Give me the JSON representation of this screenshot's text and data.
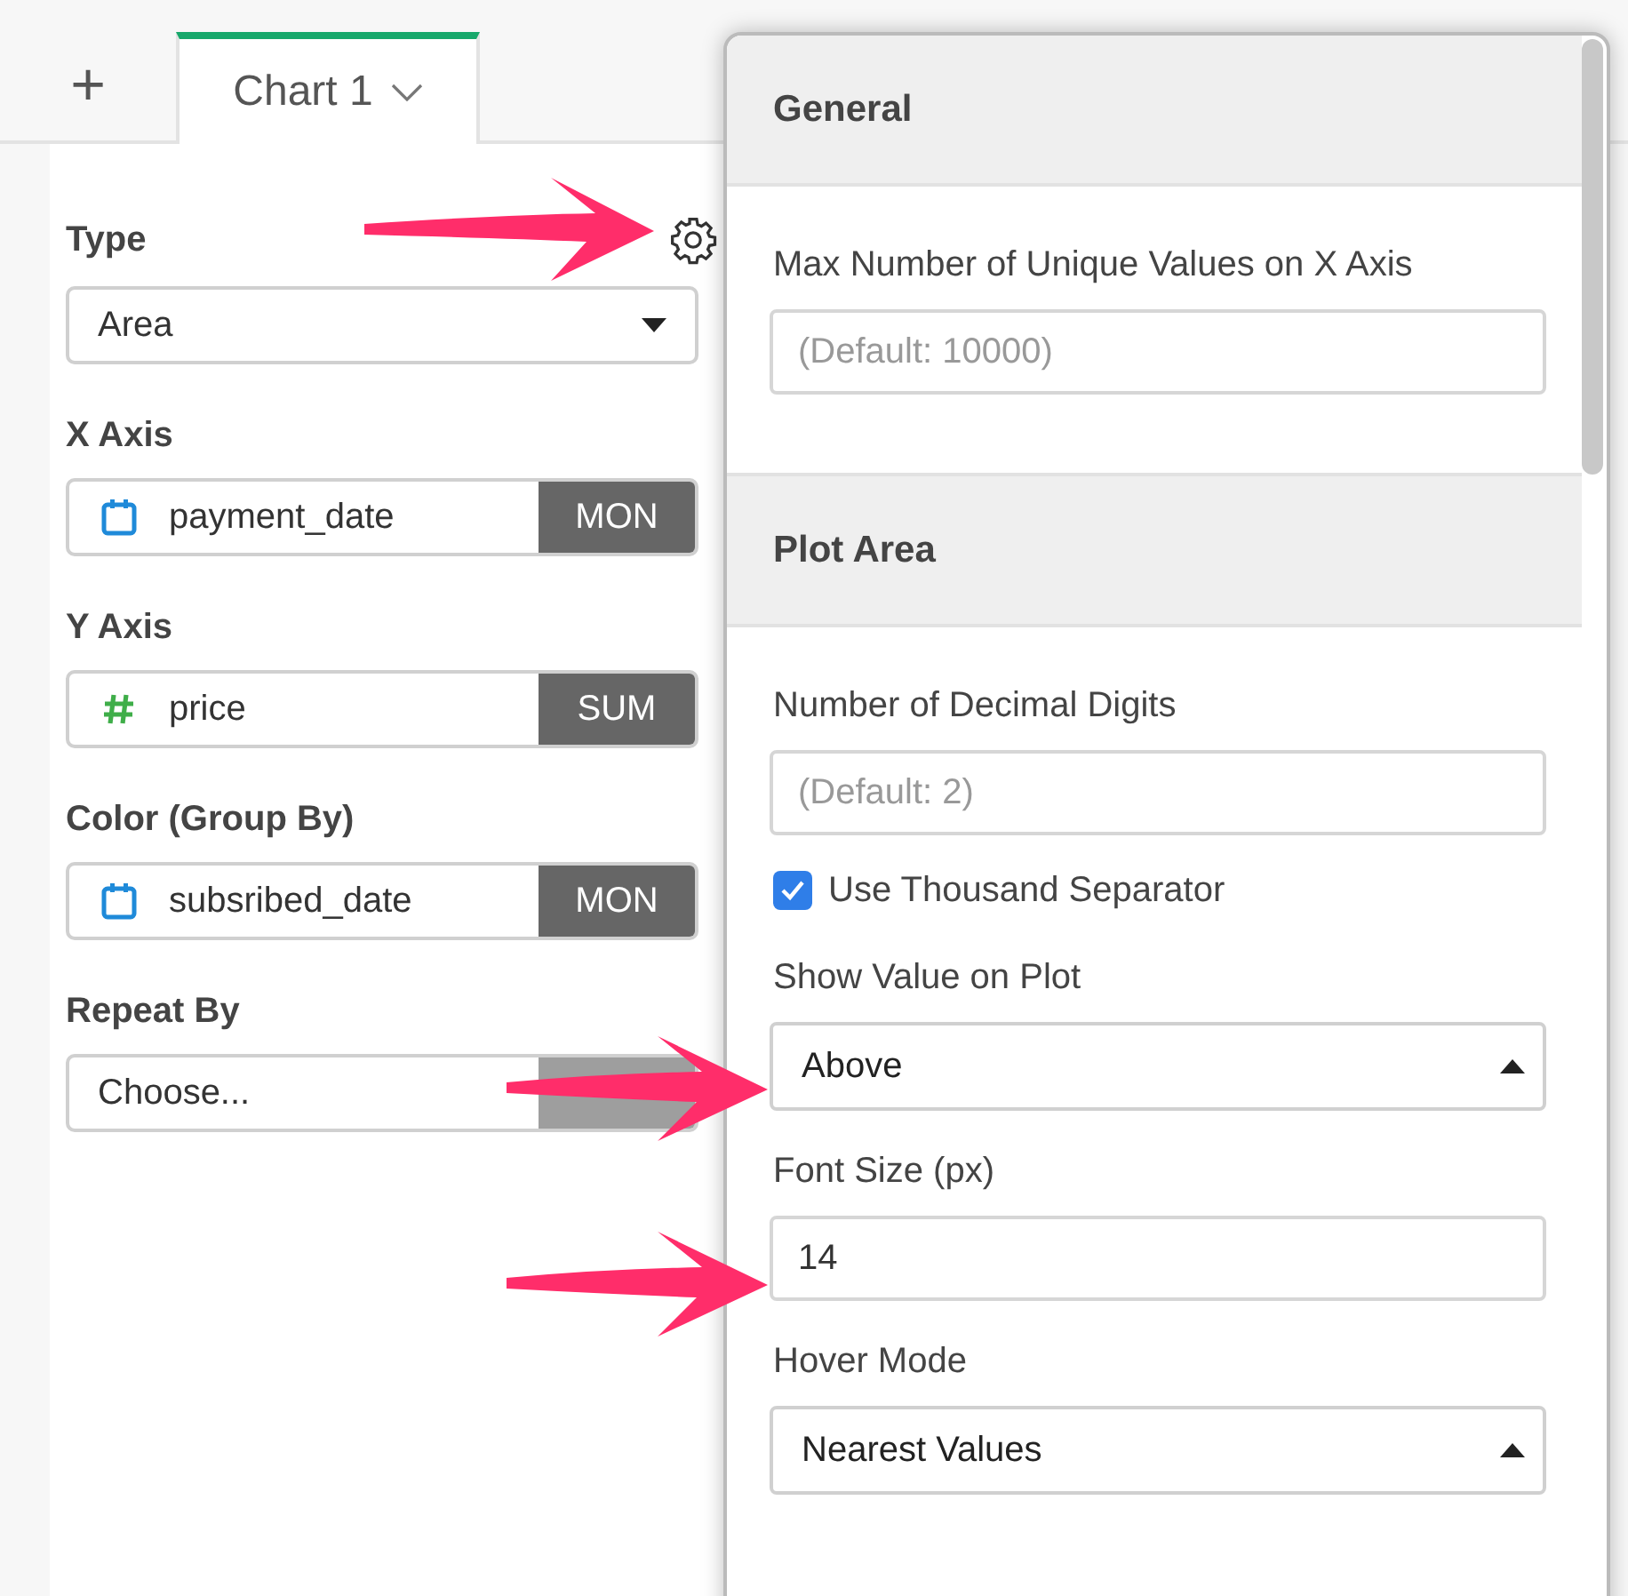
{
  "tabs": {
    "add_label": "+",
    "items": [
      {
        "label": "Chart 1",
        "selected": true
      }
    ]
  },
  "left_panel": {
    "fields": [
      {
        "kind": "select",
        "label": "Type",
        "value": "Area"
      },
      {
        "kind": "date",
        "label": "X Axis",
        "value": "payment_date",
        "aggregation": "MON"
      },
      {
        "kind": "number",
        "label": "Y Axis",
        "value": "price",
        "aggregation": "SUM"
      },
      {
        "kind": "date",
        "label": "Color (Group By)",
        "value": "subsribed_date",
        "aggregation": "MON"
      },
      {
        "kind": "empty",
        "label": "Repeat By",
        "placeholder": "Choose..."
      }
    ]
  },
  "settings_popover": {
    "sections": [
      {
        "title": "General",
        "items": [
          {
            "kind": "input",
            "label": "Max Number of Unique Values on X Axis",
            "placeholder": "(Default: 10000)"
          }
        ]
      },
      {
        "title": "Plot Area",
        "items": [
          {
            "kind": "input",
            "label": "Number of Decimal Digits",
            "placeholder": "(Default: 2)"
          },
          {
            "kind": "checkbox",
            "label": "Use Thousand Separator",
            "checked": true
          },
          {
            "kind": "select",
            "label": "Show Value on Plot",
            "value": "Above"
          },
          {
            "kind": "input",
            "label": "Font Size (px)",
            "value": "14"
          },
          {
            "kind": "select",
            "label": "Hover Mode",
            "value": "Nearest Values"
          }
        ]
      }
    ]
  }
}
